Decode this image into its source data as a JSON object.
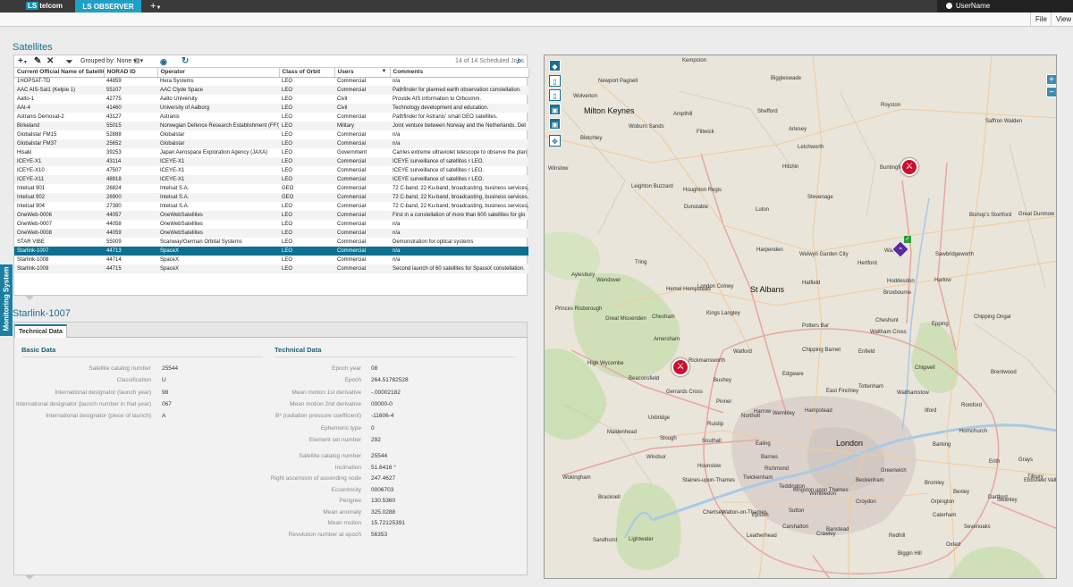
{
  "topbar": {
    "logo_mark": "LS",
    "logo_text": "telcom",
    "app_tab": "LS OBSERVER CMS",
    "plus": "+",
    "user": "UserName"
  },
  "menu": {
    "file": "File",
    "view": "View"
  },
  "side_tab": "Monitoring System",
  "satellites": {
    "title": "Satellites",
    "toolbar": {
      "grouped_by": "Grouped by: None",
      "jobs": "14 of 14 Scheduled Jobs"
    },
    "columns": [
      "Current Official Name of Satellite",
      "NORAD ID",
      "Operator",
      "Class of Orbit",
      "Users",
      "Comments"
    ],
    "rows": [
      [
        "1HOPSAT-TD",
        "44859",
        "Hera Systems",
        "LEO",
        "Commercial",
        "n/a"
      ],
      [
        "AAC AIS-Sat1 (Kelpie 1)",
        "55107",
        "AAC Clyde Space",
        "LEO",
        "Commercial",
        "Pathfinder for planned earth observation constellation."
      ],
      [
        "Aalto-1",
        "42775",
        "Aalto University",
        "LEO",
        "Civil",
        "Provide AIS information to Orbcomm."
      ],
      [
        "AAt-4",
        "41460",
        "University of Aalborg",
        "LEO",
        "Civil",
        "Technology development and education."
      ],
      [
        "Astranis Demosat-2",
        "43127",
        "Astranis",
        "LEO",
        "Commercial",
        "Pathfinder for Astranis' small GEO satellites."
      ],
      [
        "Birkeland",
        "55015",
        "Norwegian Defence Research Establishment (FFI)",
        "LEO",
        "Military",
        "Joint venture between Norway and the Netherlands. Det"
      ],
      [
        "Globalstar FM15",
        "52888",
        "Globalstar",
        "LEO",
        "Commercial",
        "n/a"
      ],
      [
        "Globalstar FM37",
        "25652",
        "Globalstar",
        "LEO",
        "Commercial",
        "n/a"
      ],
      [
        "Hisaki",
        "39253",
        "Japan Aerospace Exploration Agency (JAXA)",
        "LEO",
        "Government",
        "Carries extreme ultraviolet telescope to observe the plan"
      ],
      [
        "ICEYE-X1",
        "43114",
        "ICEYE-X1",
        "LEO",
        "Commercial",
        "ICEYE surveillance of satellites r  LEO."
      ],
      [
        "ICEYE-X10",
        "47507",
        "ICEYE-X1",
        "LEO",
        "Commercial",
        "ICEYE surveillance of satellites r  LEO."
      ],
      [
        "ICEYE-X11",
        "48918",
        "ICEYE-X1",
        "LEO",
        "Commercial",
        "ICEYE surveillance of satellites r  LEO."
      ],
      [
        "Intelsat 901",
        "26824",
        "Intelsat S.A.",
        "GEO",
        "Commercial",
        "72 C-band, 22 Ku-band, broadcasting, business services,"
      ],
      [
        "Intelsat 902",
        "26900",
        "Intelsat S.A.",
        "GEO",
        "Commercial",
        "72 C-band, 22 Ku-band, broadcasting, business services,"
      ],
      [
        "Intelsat 904",
        "27380",
        "Intelsat S.A.",
        "LEO",
        "Commercial",
        "72 C-band, 22 Ku-band, broadcasting, business services,"
      ],
      [
        "OneWeb-0006",
        "44057",
        "OneWebSatellites",
        "LEO",
        "Commercial",
        "First in a constellation of more than 600 satellites for glo"
      ],
      [
        "OneWeb-0007",
        "44058",
        "OneWebSatellites",
        "LEO",
        "Commercial",
        "n/a"
      ],
      [
        "OneWeb-0008",
        "44059",
        "OneWebSatellites",
        "LEO",
        "Commercial",
        "n/a"
      ],
      [
        "STAR VIBE",
        "55009",
        "Scanway/German Orbital Systems",
        "LEO",
        "Commercial",
        "Demonstration for optical systems"
      ],
      [
        "Starlink-1007",
        "44713",
        "SpaceX",
        "LEO",
        "Commercial",
        "n/a"
      ],
      [
        "Starlink-1008",
        "44714",
        "SpaceX",
        "LEO",
        "Commercial",
        "n/a"
      ],
      [
        "Starlink-1009",
        "44715",
        "SpaceX",
        "LEO",
        "Commercial",
        "Second launch of 60 satellites for SpaceX constellation."
      ]
    ],
    "selected_index": 19
  },
  "detail": {
    "title": "Starlink-1007",
    "tab": "Technical Data",
    "basic_title": "Basic Data",
    "tech_title": "Technical Data",
    "basic": [
      {
        "label": "Satellite catalog number",
        "value": "25544"
      },
      {
        "label": "Classification",
        "value": "U"
      },
      {
        "label": "International designator (launch year)",
        "value": "98"
      },
      {
        "label": "International designator (launch number in that year)",
        "value": "067"
      },
      {
        "label": "International designator (piece of launch)",
        "value": "A"
      }
    ],
    "tech1": [
      {
        "label": "Epoch year",
        "value": "08"
      },
      {
        "label": "Epoch",
        "value": "264.51782528"
      },
      {
        "label": "Mean motion 1st derivative",
        "value": "-.00002182"
      },
      {
        "label": "Mean motion 2nd derivative",
        "value": "00000-0"
      },
      {
        "label": "B* (radiation pressure coefficient)",
        "value": "-11606-4"
      },
      {
        "label": "Ephemeris type",
        "value": "0"
      },
      {
        "label": "Element set number",
        "value": "292"
      }
    ],
    "tech2": [
      {
        "label": "Satellite catalog number",
        "value": "25544"
      },
      {
        "label": "Inclination",
        "value": "51.6416 °"
      },
      {
        "label": "Right ascension of ascending node",
        "value": "247.4627"
      },
      {
        "label": "Eccentricity",
        "value": "0006703"
      },
      {
        "label": "Perigree",
        "value": "130.5360"
      },
      {
        "label": "Mean anomaly",
        "value": "325.0288"
      },
      {
        "label": "Mean motion",
        "value": "15.72125391"
      },
      {
        "label": "Revolution number at epoch",
        "value": "56353"
      }
    ]
  },
  "map": {
    "zoom_in": "+",
    "zoom_out": "−",
    "towns": [
      "Kempston",
      "Biggleswade",
      "Newport Pagnell",
      "Wolverton",
      "Milton Keynes",
      "Royston",
      "Saffron Walden",
      "Woburn Sands",
      "Ampthill",
      "Shefford",
      "Arlesey",
      "Letchworth",
      "Bletchley",
      "Flitwick",
      "Hitchin",
      "Buntingford",
      "Winslow",
      "Leighton Buzzard",
      "Houghton Regis",
      "Stevenage",
      "Dunstable",
      "Luton",
      "Bishop's Stortford",
      "Great Dunmow",
      "Aylesbury",
      "Tring",
      "Harpenden",
      "Welwyn Garden City",
      "Hertford",
      "Ware",
      "Sawbridgeworth",
      "Wendover",
      "Hemel Hempstead",
      "St Albans",
      "Hatfield",
      "Hoddesdon",
      "Harlow",
      "Princes Risborough",
      "Great Missenden",
      "Chesham",
      "Kings Langley",
      "Broxbourne",
      "Cheshunt",
      "Epping",
      "Chipping Ongar",
      "Amersham",
      "Watford",
      "Potters Bar",
      "Waltham Cross",
      "High Wycombe",
      "Beaconsfield",
      "Rickmansworth",
      "Chipping Barnet",
      "Enfield",
      "Chigwell",
      "Brentwood",
      "Gerrards Cross",
      "Edgware",
      "East Finchley",
      "Tottenham",
      "Walthamstow",
      "Uxbridge",
      "Northolt",
      "Wembley",
      "Hampstead",
      "Ilford",
      "Romford",
      "Maidenhead",
      "Slough",
      "Southall",
      "Ealing",
      "London",
      "Barking",
      "Windsor",
      "Hounslow",
      "Richmond",
      "Greenwich",
      "Erith",
      "Staines-upon-Thames",
      "Kingston upon Thames",
      "Wimbledon",
      "Bexley",
      "Dartford",
      "Bracknell",
      "Chertsey",
      "Walton-on-Thames",
      "Sutton",
      "Croydon",
      "Bromley",
      "Orpington",
      "Swanley",
      "Sandhurst",
      "Lightwater",
      "Epsom",
      "Leatherhead",
      "Caterham",
      "Biggin Hill",
      "Sevenoaks",
      "London Colney",
      "Harrow",
      "Pinner",
      "Ruislip",
      "Bushey",
      "Wokingham",
      "Teddington",
      "Twickenham",
      "Beckenham",
      "Grays",
      "Tilbury",
      "Ebbsfleet Valley",
      "Hornchurch",
      "Barnes",
      "Crawley",
      "Carshalton",
      "Banstead",
      "Redhill",
      "Oxted"
    ]
  }
}
